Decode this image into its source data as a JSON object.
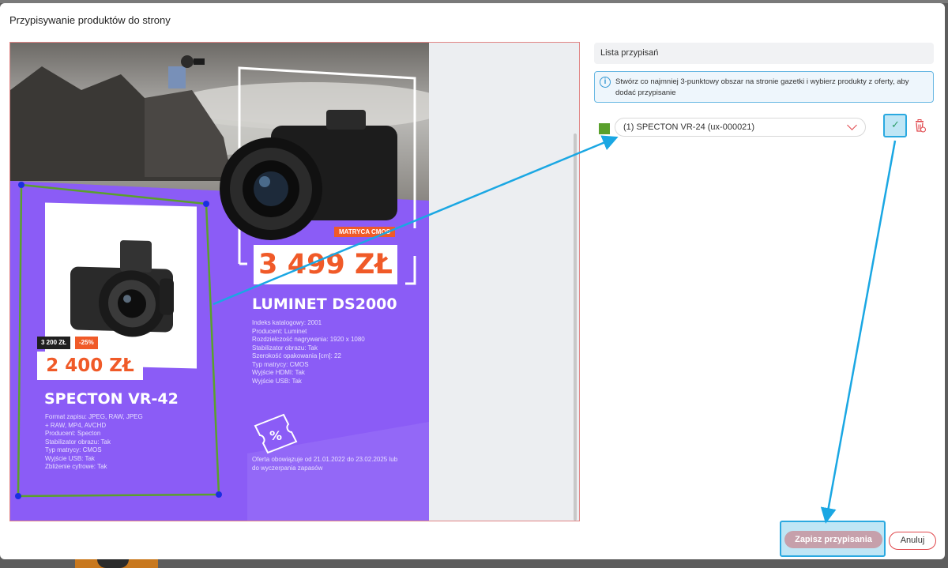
{
  "modal": {
    "title": "Przypisywanie produktów do strony"
  },
  "flyer": {
    "product_1": {
      "old_price": "3 200 ZŁ",
      "discount": "-25%",
      "price": "2 400 ZŁ",
      "name": "SPECTON VR-42",
      "specs": [
        "Format zapisu: JPEG, RAW, JPEG",
        "+ RAW, MP4, AVCHD",
        "Producent: Specton",
        "Stabilizator obrazu: Tak",
        "Typ matrycy: CMOS",
        "Wyjście USB: Tak",
        "Zbliżenie cyfrowe: Tak"
      ]
    },
    "product_2": {
      "badge": "MATRYCA CMOS",
      "price": "3 499 ZŁ",
      "name": "LUMINET DS2000",
      "specs": [
        "Indeks katalogowy: 2001",
        "Producent: Luminet",
        "Rozdzielczość nagrywania: 1920 x 1080",
        "Stabilizator obrazu: Tak",
        "Szerokość opakowania [cm]: 22",
        "Typ matrycy: CMOS",
        "Wyjście HDMI: Tak",
        "Wyjście USB: Tak"
      ]
    },
    "offer": "Oferta obowiązuje od 21.01.2022 do 23.02.2025 lub do wyczerpania zapasów"
  },
  "panel": {
    "header": "Lista przypisań",
    "info": "Stwórz co najmniej 3-punktowy obszar na stronie gazetki i wybierz produkty z oferty, aby dodać przypisanie",
    "assignment": {
      "label": "(1) SPECTON VR-24 (ux-000021)",
      "color": "#5aa02c"
    }
  },
  "buttons": {
    "save": "Zapisz przypisania",
    "cancel": "Anuluj"
  },
  "colors": {
    "accent": "#e0474c",
    "highlight": "#2aa9e0",
    "flyer_purple": "#8b5cf6",
    "price_orange": "#f05a28"
  }
}
